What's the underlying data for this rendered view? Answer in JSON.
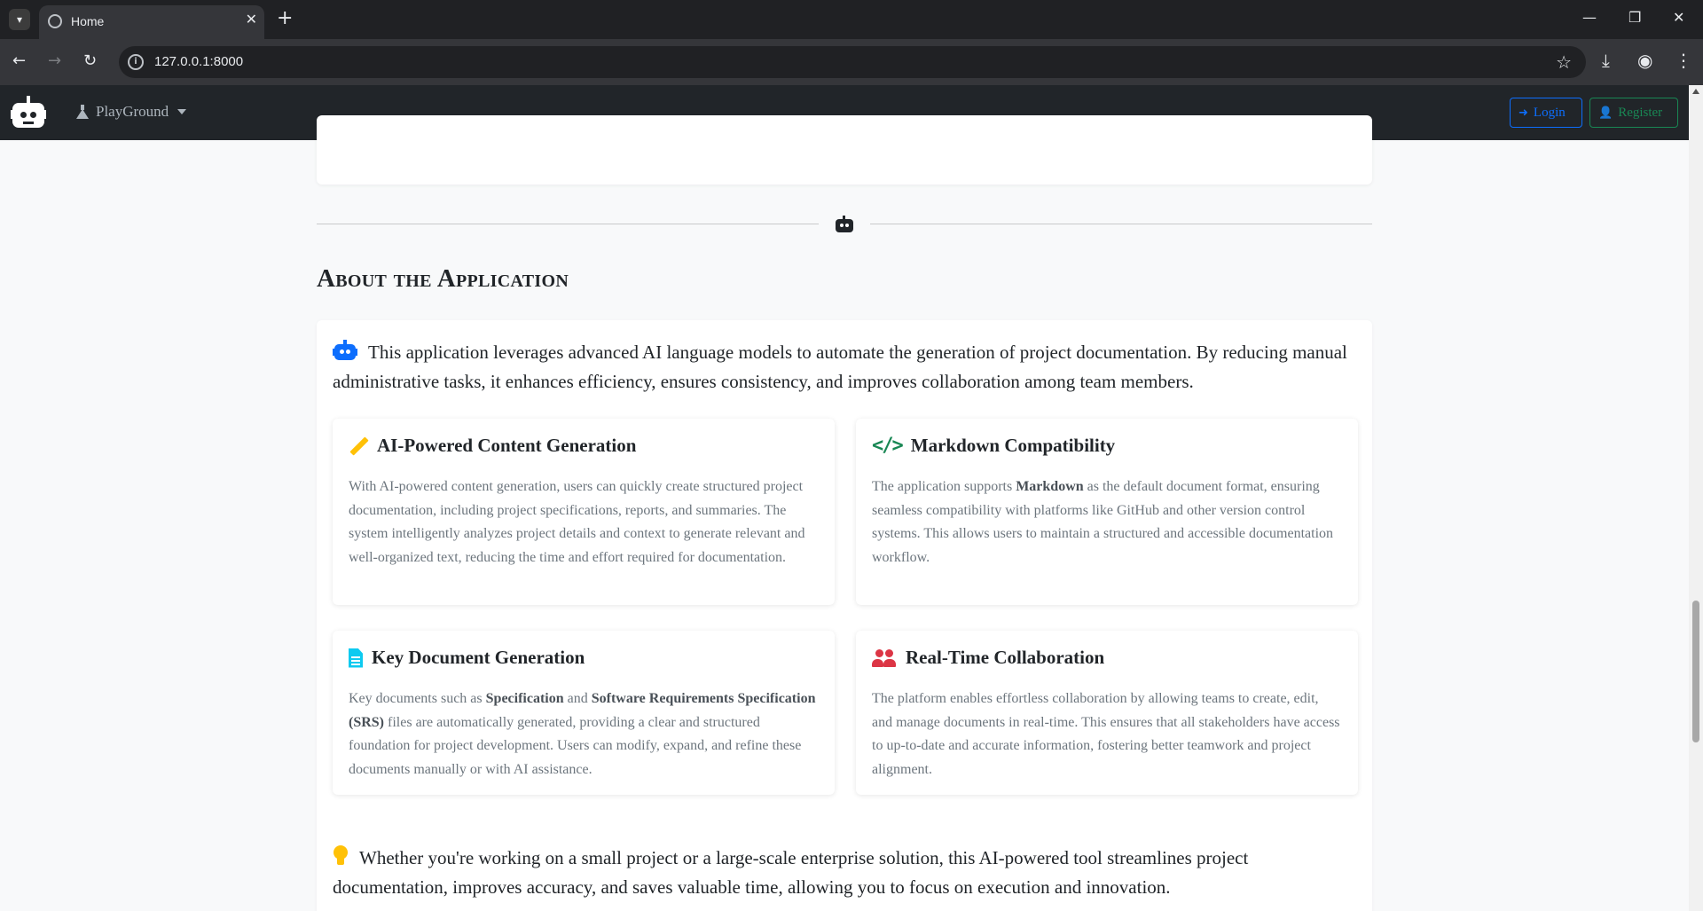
{
  "browser": {
    "tab_title": "Home",
    "url": "127.0.0.1:8000"
  },
  "navbar": {
    "dropdown_label": "PlayGround",
    "login_label": "Login",
    "register_label": "Register"
  },
  "about": {
    "title": "About the Application",
    "intro": "This application leverages advanced AI language models to automate the generation of project documentation. By reducing manual administrative tasks, it enhances efficiency, ensures consistency, and improves collaboration among team members.",
    "features": [
      {
        "title": "AI-Powered Content Generation",
        "icon": "pencil-icon",
        "text": "With AI-powered content generation, users can quickly create structured project documentation, including project specifications, reports, and summaries. The system intelligently analyzes project details and context to generate relevant and well-organized text, reducing the time and effort required for documentation."
      },
      {
        "title": "Markdown Compatibility",
        "icon": "code-icon",
        "text_before": "The application supports ",
        "text_bold": "Markdown",
        "text_after": " as the default document format, ensuring seamless compatibility with platforms like GitHub and other version control systems. This allows users to maintain a structured and accessible documentation workflow."
      },
      {
        "title": "Key Document Generation",
        "icon": "document-icon",
        "text_1": "Key documents such as ",
        "bold_1": "Specification",
        "text_2": " and ",
        "bold_2": "Software Requirements Specification (SRS)",
        "text_3": " files are automatically generated, providing a clear and structured foundation for project development. Users can modify, expand, and refine these documents manually or with AI assistance."
      },
      {
        "title": "Real-Time Collaboration",
        "icon": "users-icon",
        "text": "The platform enables effortless collaboration by allowing teams to create, edit, and manage documents in real-time. This ensures that all stakeholders have access to up-to-date and accurate information, fostering better teamwork and project alignment."
      }
    ],
    "outro": "Whether you're working on a small project or a large-scale enterprise solution, this AI-powered tool streamlines project documentation, improves accuracy, and saves valuable time, allowing you to focus on execution and innovation."
  },
  "colors": {
    "primary": "#0d6efd",
    "success": "#198754",
    "warning": "#ffc107",
    "info": "#0dcaf0",
    "danger": "#dc3545",
    "navbar": "#212529"
  }
}
